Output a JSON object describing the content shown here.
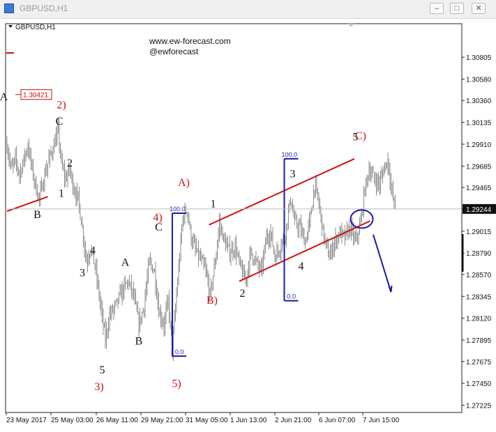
{
  "window": {
    "title": "GBPUSD,H1",
    "buttons": {
      "minimize": "–",
      "maximize": "□",
      "close": "✕"
    }
  },
  "chart_header": "GBPUSD,H1",
  "watermark": {
    "url": "www.ew-forecast.com",
    "handle": "@ewforecast"
  },
  "colors": {
    "candles": "#8c8c8c",
    "trend": "#d01010",
    "fib": "#1a1aa8",
    "projection": "#1a1aa8",
    "red_label": "#d01010",
    "price_tag_bg": "#d01010"
  },
  "chart_data": {
    "type": "candlestick",
    "symbol": "GBPUSD",
    "timeframe": "H1",
    "ylim": [
      1.2715,
      1.3115
    ],
    "y_ticks": [
      1.30805,
      1.3058,
      1.3036,
      1.30135,
      1.2991,
      1.29685,
      1.29465,
      1.29244,
      1.29015,
      1.2879,
      1.2857,
      1.28345,
      1.2812,
      1.27895,
      1.27675,
      1.2745,
      1.27225
    ],
    "y_tick_labels": [
      "1.30805",
      "1.30580",
      "1.30360",
      "1.30135",
      "1.29910",
      "1.29685",
      "1.29465",
      "1.29244",
      "1.29015",
      "1.28790",
      "1.28570",
      "1.28345",
      "1.28120",
      "1.27895",
      "1.27675",
      "1.27450",
      "1.27225"
    ],
    "current_price": "1.29244",
    "x_labels": [
      "23 May 2017",
      "25 May 03:00",
      "26 May 11:00",
      "29 May 21:00",
      "31 May 05:00",
      "1 Jun 13:00",
      "2 Jun 21:00",
      "6 Jun 07:00",
      "7 Jun 15:00"
    ],
    "price_level_label": "1.30421",
    "price_path": [
      {
        "bar": 0,
        "price": 1.299
      },
      {
        "bar": 4,
        "price": 1.2965
      },
      {
        "bar": 8,
        "price": 1.2975
      },
      {
        "bar": 12,
        "price": 1.296
      },
      {
        "bar": 16,
        "price": 1.2975
      },
      {
        "bar": 20,
        "price": 1.299
      },
      {
        "bar": 24,
        "price": 1.2965
      },
      {
        "bar": 28,
        "price": 1.2945
      },
      {
        "bar": 31,
        "price": 1.2935
      },
      {
        "bar": 35,
        "price": 1.2955
      },
      {
        "bar": 40,
        "price": 1.2975
      },
      {
        "bar": 45,
        "price": 1.299
      },
      {
        "bar": 49,
        "price": 1.3005
      },
      {
        "bar": 52,
        "price": 1.297
      },
      {
        "bar": 56,
        "price": 1.2955
      },
      {
        "bar": 60,
        "price": 1.2965
      },
      {
        "bar": 64,
        "price": 1.2945
      },
      {
        "bar": 68,
        "price": 1.2935
      },
      {
        "bar": 72,
        "price": 1.2905
      },
      {
        "bar": 76,
        "price": 1.287
      },
      {
        "bar": 80,
        "price": 1.2885
      },
      {
        "bar": 85,
        "price": 1.286
      },
      {
        "bar": 90,
        "price": 1.282
      },
      {
        "bar": 94,
        "price": 1.279
      },
      {
        "bar": 98,
        "price": 1.2815
      },
      {
        "bar": 104,
        "price": 1.2825
      },
      {
        "bar": 110,
        "price": 1.284
      },
      {
        "bar": 116,
        "price": 1.285
      },
      {
        "bar": 121,
        "price": 1.2835
      },
      {
        "bar": 126,
        "price": 1.2805
      },
      {
        "bar": 131,
        "price": 1.2825
      },
      {
        "bar": 136,
        "price": 1.287
      },
      {
        "bar": 141,
        "price": 1.286
      },
      {
        "bar": 145,
        "price": 1.282
      },
      {
        "bar": 150,
        "price": 1.2805
      },
      {
        "bar": 154,
        "price": 1.283
      },
      {
        "bar": 158,
        "price": 1.278
      },
      {
        "bar": 163,
        "price": 1.285
      },
      {
        "bar": 168,
        "price": 1.2915
      },
      {
        "bar": 172,
        "price": 1.2925
      },
      {
        "bar": 176,
        "price": 1.2895
      },
      {
        "bar": 181,
        "price": 1.288
      },
      {
        "bar": 186,
        "price": 1.287
      },
      {
        "bar": 190,
        "price": 1.286
      },
      {
        "bar": 194,
        "price": 1.2835
      },
      {
        "bar": 199,
        "price": 1.287
      },
      {
        "bar": 203,
        "price": 1.291
      },
      {
        "bar": 208,
        "price": 1.289
      },
      {
        "bar": 213,
        "price": 1.288
      },
      {
        "bar": 218,
        "price": 1.2885
      },
      {
        "bar": 223,
        "price": 1.2865
      },
      {
        "bar": 228,
        "price": 1.285
      },
      {
        "bar": 233,
        "price": 1.288
      },
      {
        "bar": 238,
        "price": 1.287
      },
      {
        "bar": 243,
        "price": 1.286
      },
      {
        "bar": 248,
        "price": 1.2895
      },
      {
        "bar": 252,
        "price": 1.29
      },
      {
        "bar": 256,
        "price": 1.2875
      },
      {
        "bar": 261,
        "price": 1.2885
      },
      {
        "bar": 266,
        "price": 1.29
      },
      {
        "bar": 271,
        "price": 1.2935
      },
      {
        "bar": 275,
        "price": 1.291
      },
      {
        "bar": 280,
        "price": 1.2905
      },
      {
        "bar": 285,
        "price": 1.289
      },
      {
        "bar": 290,
        "price": 1.2915
      },
      {
        "bar": 294,
        "price": 1.295
      },
      {
        "bar": 298,
        "price": 1.293
      },
      {
        "bar": 303,
        "price": 1.2895
      },
      {
        "bar": 308,
        "price": 1.2875
      },
      {
        "bar": 313,
        "price": 1.289
      },
      {
        "bar": 318,
        "price": 1.29
      },
      {
        "bar": 323,
        "price": 1.2895
      },
      {
        "bar": 328,
        "price": 1.2905
      },
      {
        "bar": 333,
        "price": 1.289
      },
      {
        "bar": 338,
        "price": 1.291
      },
      {
        "bar": 342,
        "price": 1.2945
      },
      {
        "bar": 346,
        "price": 1.2965
      },
      {
        "bar": 351,
        "price": 1.2955
      },
      {
        "bar": 356,
        "price": 1.295
      },
      {
        "bar": 360,
        "price": 1.2965
      },
      {
        "bar": 364,
        "price": 1.2975
      },
      {
        "bar": 368,
        "price": 1.294
      },
      {
        "bar": 371,
        "price": 1.2925
      }
    ],
    "annotations": {
      "wave_labels_black": [
        {
          "text": "A",
          "bar": -3,
          "price": 1.3036
        },
        {
          "text": "C",
          "bar": 50,
          "price": 1.3011
        },
        {
          "text": "B",
          "bar": 29,
          "price": 1.2915
        },
        {
          "text": "2",
          "bar": 60,
          "price": 1.2968
        },
        {
          "text": "1",
          "bar": 52,
          "price": 1.2937
        },
        {
          "text": "4",
          "bar": 82,
          "price": 1.2878
        },
        {
          "text": "3",
          "bar": 72,
          "price": 1.2855
        },
        {
          "text": "5",
          "bar": 91,
          "price": 1.2755
        },
        {
          "text": "A",
          "bar": 113,
          "price": 1.2866
        },
        {
          "text": "B",
          "bar": 126,
          "price": 1.2785
        },
        {
          "text": "C",
          "bar": 145,
          "price": 1.2902
        },
        {
          "text": "1",
          "bar": 197,
          "price": 1.2926
        },
        {
          "text": "2",
          "bar": 225,
          "price": 1.2834
        },
        {
          "text": "3",
          "bar": 273,
          "price": 1.2957
        },
        {
          "text": "4",
          "bar": 281,
          "price": 1.2862
        },
        {
          "text": "5",
          "bar": 333,
          "price": 1.2995
        }
      ],
      "wave_labels_red": [
        {
          "text": "2)",
          "bar": 52,
          "price": 1.3028
        },
        {
          "text": "3)",
          "bar": 88,
          "price": 1.2738
        },
        {
          "text": "4)",
          "bar": 144,
          "price": 1.2912
        },
        {
          "text": "5)",
          "bar": 162,
          "price": 1.2741
        },
        {
          "text": "A)",
          "bar": 169,
          "price": 1.2948
        },
        {
          "text": "B)",
          "bar": 196,
          "price": 1.2827
        },
        {
          "text": "C)",
          "bar": 338,
          "price": 1.2996
        }
      ],
      "channel_lines": [
        {
          "from": {
            "bar": 0,
            "price": 1.2922
          },
          "to": {
            "bar": 39,
            "price": 1.2937
          }
        },
        {
          "from": {
            "bar": 193,
            "price": 1.2908
          },
          "to": {
            "bar": 332,
            "price": 1.2976
          }
        },
        {
          "from": {
            "bar": 222,
            "price": 1.285
          },
          "to": {
            "bar": 347,
            "price": 1.2912
          }
        }
      ],
      "fib_tools": [
        {
          "top_label": "100.0",
          "bottom_label": "0.0",
          "bar": 158,
          "price_top": 1.292,
          "price_bottom": 1.2773
        },
        {
          "top_label": "100.0",
          "bottom_label": "0.0",
          "bar": 265,
          "price_top": 1.2976,
          "price_bottom": 1.283
        }
      ],
      "target_circle": {
        "bar": 339,
        "price": 1.2914
      },
      "projection_arrow": {
        "from": {
          "bar": 350,
          "price": 1.2898
        },
        "to": {
          "bar": 367,
          "price": 1.2839
        }
      }
    }
  }
}
